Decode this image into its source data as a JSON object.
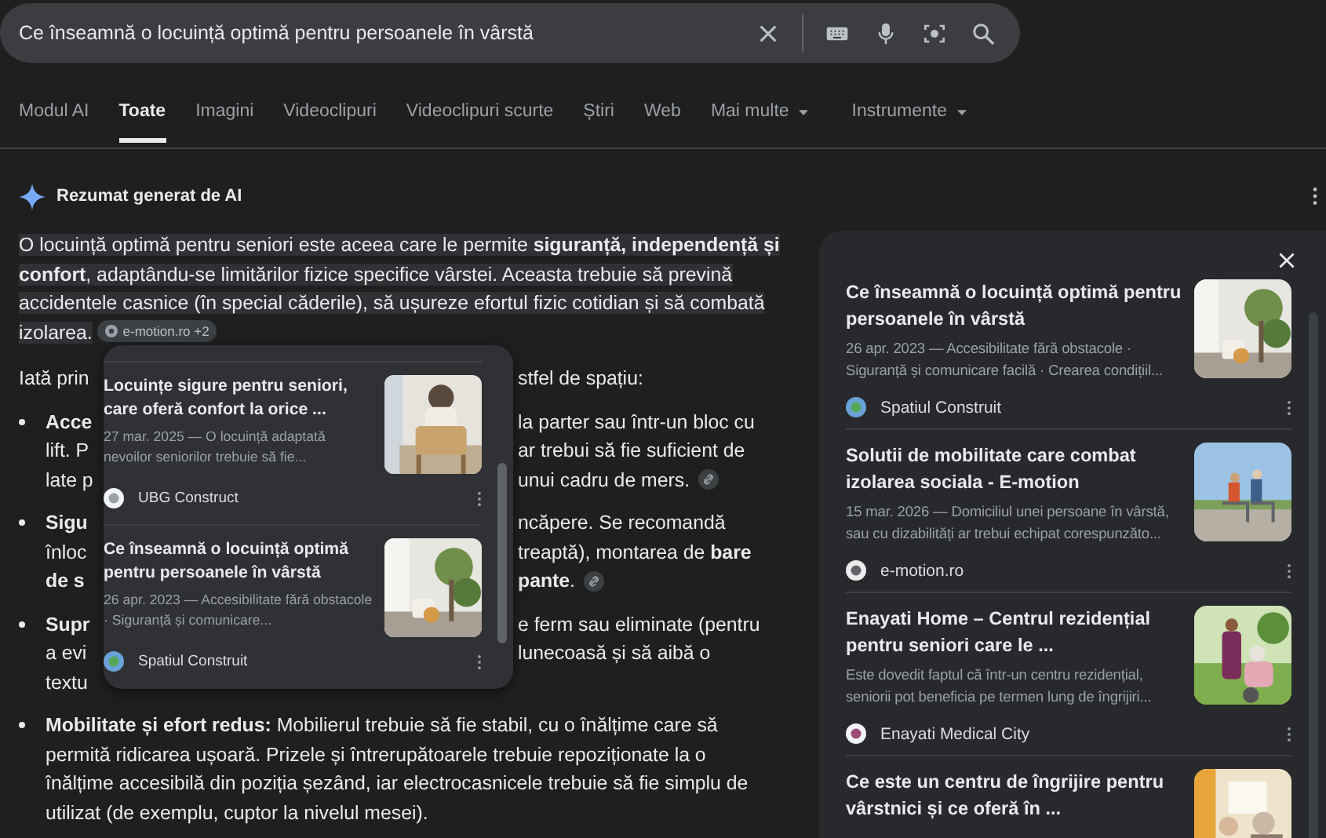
{
  "search": {
    "query": "Ce înseamnă o locuință optimă pentru persoanele în vârstă"
  },
  "tabs": [
    {
      "label": "Modul AI",
      "selected": false,
      "has_menu": false
    },
    {
      "label": "Toate",
      "selected": true,
      "has_menu": false
    },
    {
      "label": "Imagini",
      "selected": false,
      "has_menu": false
    },
    {
      "label": "Videoclipuri",
      "selected": false,
      "has_menu": false
    },
    {
      "label": "Videoclipuri scurte",
      "selected": false,
      "has_menu": false
    },
    {
      "label": "Știri",
      "selected": false,
      "has_menu": false
    },
    {
      "label": "Web",
      "selected": false,
      "has_menu": false
    },
    {
      "label": "Mai multe",
      "selected": false,
      "has_menu": true
    },
    {
      "label": "Instrumente",
      "selected": false,
      "has_menu": true
    }
  ],
  "ai_overview": {
    "title": "Rezumat generat de AI",
    "summary": "O locuință optimă pentru seniori este aceea care le permite **siguranță, independență și confort**, adaptându-se limitărilor fizice specifice vârstei. Aceasta trebuie să prevină accidentele casnice (în special căderile), să ușureze efortul fizic cotidian și să combată izolarea.",
    "source_chip": "e-motion.ro +2",
    "intro": {
      "left": "Iată prin",
      "right": "stfel de spațiu:"
    },
    "bullets": [
      {
        "lines": [
          {
            "left": "**Acce**",
            "right": "la parter sau într-un bloc cu",
            "link": false
          },
          {
            "left": "lift. P",
            "right": "ar trebui să fie suficient de",
            "link": false
          },
          {
            "left": "late p",
            "right": "unui cadru de mers.",
            "link": true
          }
        ]
      },
      {
        "lines": [
          {
            "left": "**Sigu**",
            "right": "ncăpere. Se recomandă",
            "link": false
          },
          {
            "left": "înloc",
            "right": "treaptă), montarea de **bare**",
            "link": false
          },
          {
            "left": "**de s**",
            "right": "**pante**.",
            "link": true
          }
        ]
      },
      {
        "lines": [
          {
            "left": "**Supr**",
            "right": "e ferm sau eliminate (pentru",
            "link": false
          },
          {
            "left": "a evi",
            "right": "lunecoasă și să aibă o",
            "link": false
          },
          {
            "left": "textu",
            "link": false
          }
        ]
      },
      {
        "text": "**Mobilitate și efort redus:** Mobilierul trebuie să fie stabil, cu o înălțime care să permită ridicarea ușoară. Prizele și întrerupătoarele trebuie repoziționate la o înălțime accesibilă din poziția șezând, iar electrocasnicele trebuie să fie simplu de utilizat (de exemplu, cuptor la nivelul mesei)."
      }
    ]
  },
  "popup": {
    "results": [
      {
        "title": "Locuințe sigure pentru seniori, care oferă confort la orice ...",
        "snippet": "27 mar. 2025 — O locuință adaptată nevoilor seniorilor trebuie să fie...",
        "source": "UBG Construct"
      },
      {
        "title": "Ce înseamnă o locuință optimă pentru persoanele în vârstă",
        "snippet": "26 apr. 2023 — Accesibilitate fără obstacole · Siguranță și comunicare...",
        "source": "Spatiul Construit"
      }
    ]
  },
  "side_panel": {
    "results": [
      {
        "title": "Ce înseamnă o locuință optimă pentru persoanele în vârstă",
        "snippet": "26 apr. 2023 — Accesibilitate fără obstacole · Siguranță și comunicare facilă · Crearea condițiil...",
        "source": "Spatiul Construit"
      },
      {
        "title": "Solutii de mobilitate care combat izolarea sociala - E-motion",
        "snippet": "15 mar. 2026 — Domiciliul unei persoane în vârstă, sau cu dizabilități ar trebui echipat corespunzăto...",
        "source": "e-motion.ro"
      },
      {
        "title": "Enayati Home – Centrul rezidențial pentru seniori care le ...",
        "snippet": "Este dovedit faptul că într-un centru rezidențial, seniorii pot beneficia pe termen lung de îngrijiri...",
        "source": "Enayati Medical City"
      },
      {
        "title": "Ce este un centru de îngrijire pentru vârstnici și ce oferă în ..."
      }
    ]
  }
}
